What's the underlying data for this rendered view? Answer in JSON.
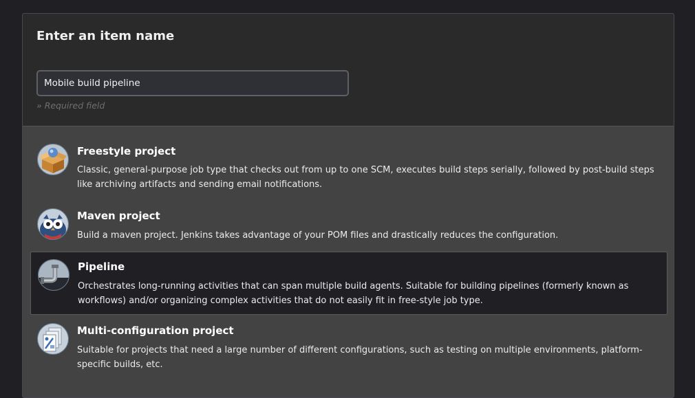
{
  "form": {
    "title": "Enter an item name",
    "name_value": "Mobile build pipeline",
    "required_hint": "» Required field"
  },
  "items": [
    {
      "title": "Freestyle project",
      "description": "Classic, general-purpose job type that checks out from up to one SCM, executes build steps serially, followed by post-build steps like archiving artifacts and sending email notifications.",
      "icon": "freestyle-box-icon",
      "selected": false
    },
    {
      "title": "Maven project",
      "description": "Build a maven project. Jenkins takes advantage of your POM files and drastically reduces the configuration.",
      "icon": "maven-owl-icon",
      "selected": false
    },
    {
      "title": "Pipeline",
      "description": "Orchestrates long-running activities that can span multiple build agents. Suitable for building pipelines (formerly known as workflows) and/or organizing complex activities that do not easily fit in free-style job type.",
      "icon": "pipeline-pipe-icon",
      "selected": true
    },
    {
      "title": "Multi-configuration project",
      "description": "Suitable for projects that need a large number of different configurations, such as testing on multiple environments, platform-specific builds, etc.",
      "icon": "multi-configuration-icon",
      "selected": false
    }
  ],
  "colors": {
    "background": "#1f1f24",
    "panel": "#434343",
    "header": "#2b2a2a",
    "selected_item": "#1f1f24"
  }
}
